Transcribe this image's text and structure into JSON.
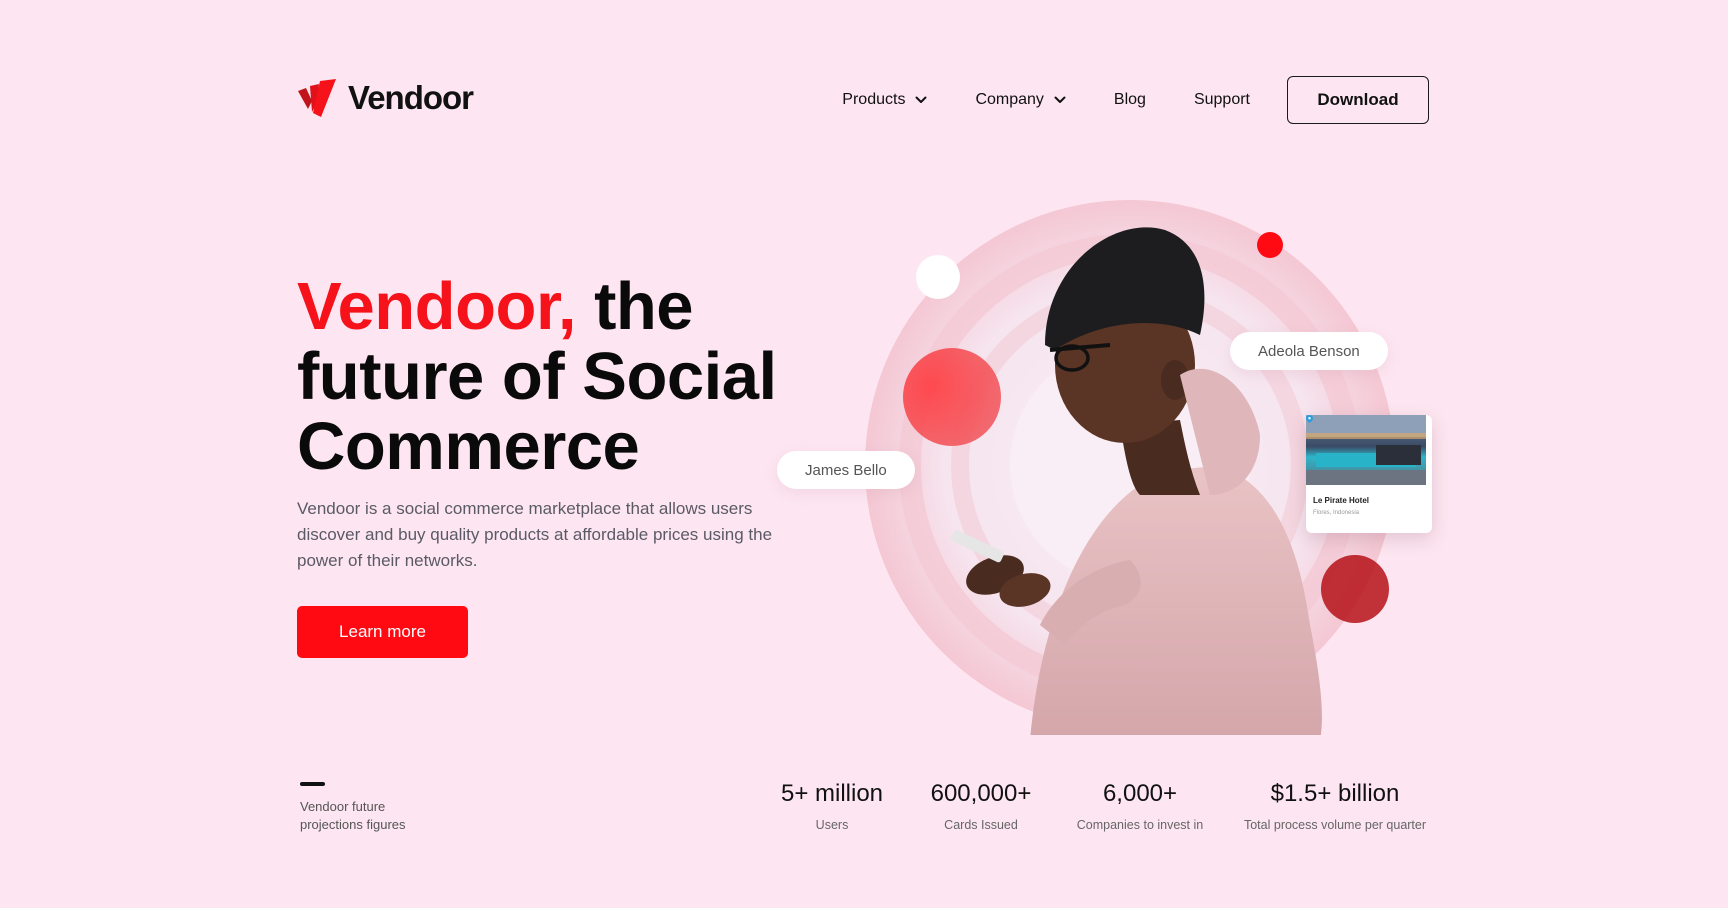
{
  "brand": {
    "name": "Vendoor",
    "red": "#f5121a",
    "dark_red": "#b51117",
    "background": "#fde6f1"
  },
  "nav": {
    "items": [
      {
        "label": "Products",
        "has_dropdown": true
      },
      {
        "label": "Company",
        "has_dropdown": true
      },
      {
        "label": "Blog",
        "has_dropdown": false
      },
      {
        "label": "Support",
        "has_dropdown": false
      }
    ],
    "download_label": "Download"
  },
  "hero": {
    "title_accent": "Vendoor,",
    "title_rest": " the future of Social Commerce",
    "description": "Vendoor is a social commerce marketplace that allows users discover and buy quality products at affordable prices using the power of their networks.",
    "cta_label": "Learn more"
  },
  "illustration": {
    "tag_left": "James Bello",
    "tag_right": "Adeola Benson",
    "hotel": {
      "name": "Le Pirate Hotel",
      "location": "Flores, Indonesia",
      "icon": "location-pin-icon"
    }
  },
  "stats": {
    "caption": "Vendoor future projections figures",
    "items": [
      {
        "value": "5+ million",
        "label": "Users"
      },
      {
        "value": "600,000+",
        "label": "Cards Issued"
      },
      {
        "value": "6,000+",
        "label": "Companies to invest in"
      },
      {
        "value": "$1.5+ billion",
        "label": "Total process volume per quarter"
      }
    ]
  }
}
